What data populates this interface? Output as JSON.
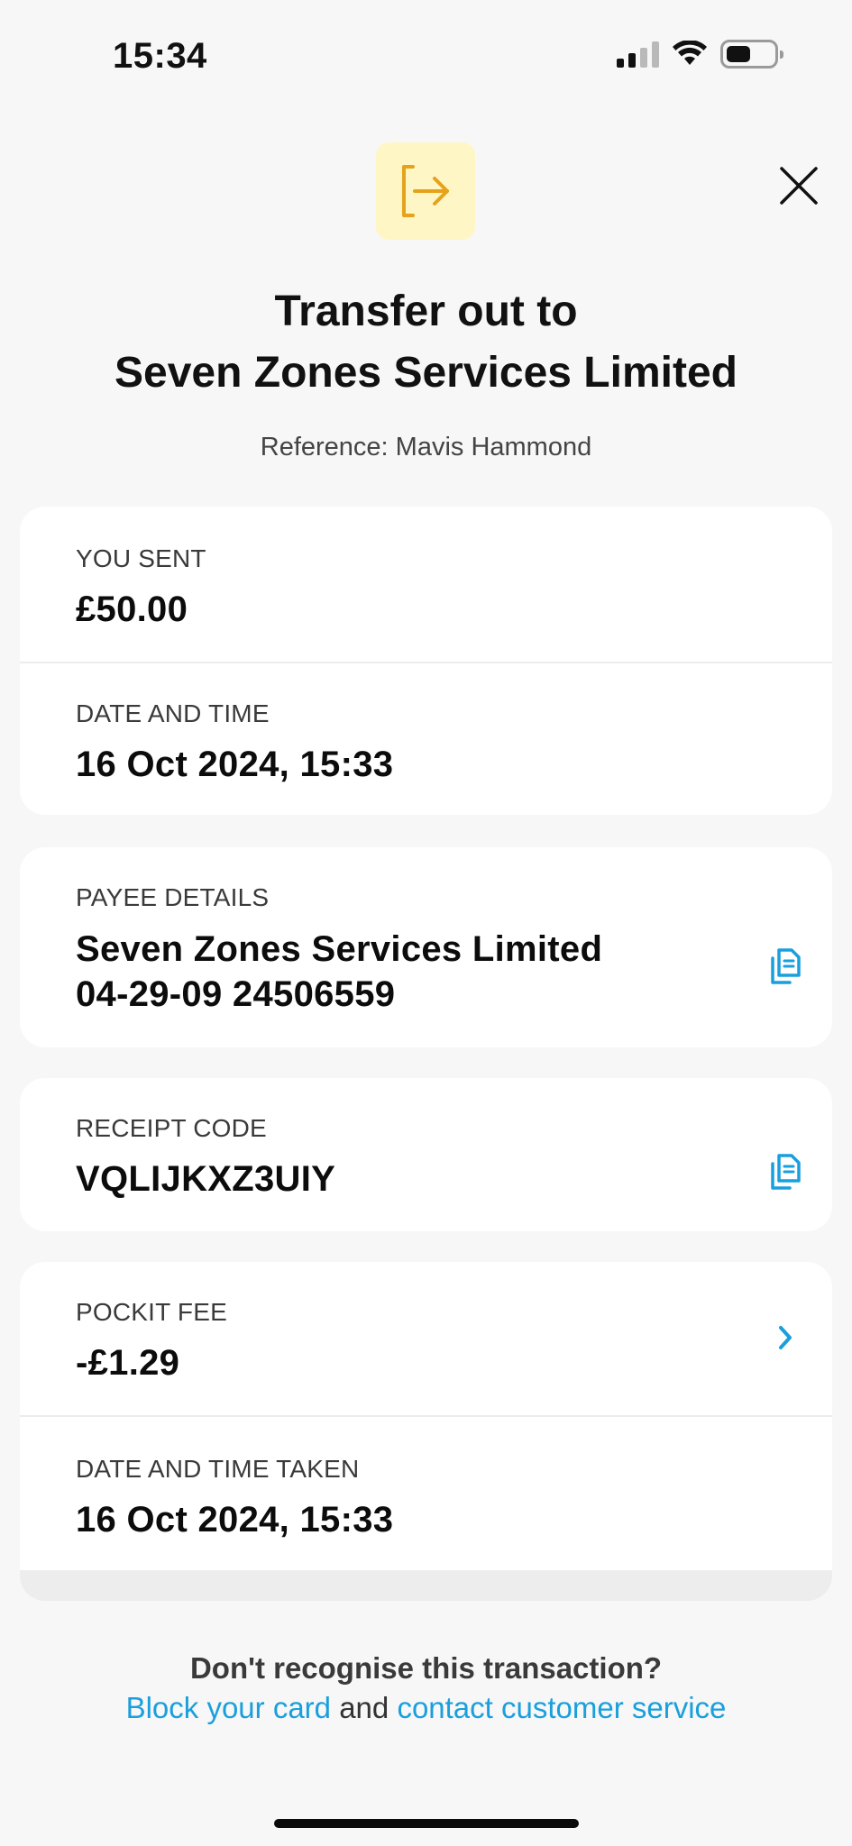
{
  "status_bar": {
    "time": "15:34"
  },
  "header": {
    "icon": "transfer-out-icon",
    "title_line1": "Transfer out to",
    "title_line2": "Seven Zones Services Limited",
    "reference": "Reference: Mavis Hammond"
  },
  "sent_card": {
    "you_sent_label": "YOU SENT",
    "you_sent_value": "£50.00",
    "datetime_label": "DATE AND TIME",
    "datetime_value": "16 Oct 2024, 15:33"
  },
  "payee_card": {
    "label": "PAYEE DETAILS",
    "name": "Seven Zones Services Limited",
    "account": "04-29-09 24506559"
  },
  "receipt_card": {
    "label": "RECEIPT CODE",
    "value": "VQLIJKXZ3UIY"
  },
  "fee_card": {
    "fee_label": "POCKIT FEE",
    "fee_value": "-£1.29",
    "taken_label": "DATE AND TIME TAKEN",
    "taken_value": "16 Oct 2024, 15:33"
  },
  "footer": {
    "question": "Don't recognise this transaction?",
    "block_link": "Block your card",
    "and_text": " and ",
    "contact_link": "contact customer service"
  },
  "colors": {
    "accent_blue": "#1a9fdd",
    "icon_orange": "#e6a21b",
    "icon_bg": "#fff6c6"
  }
}
